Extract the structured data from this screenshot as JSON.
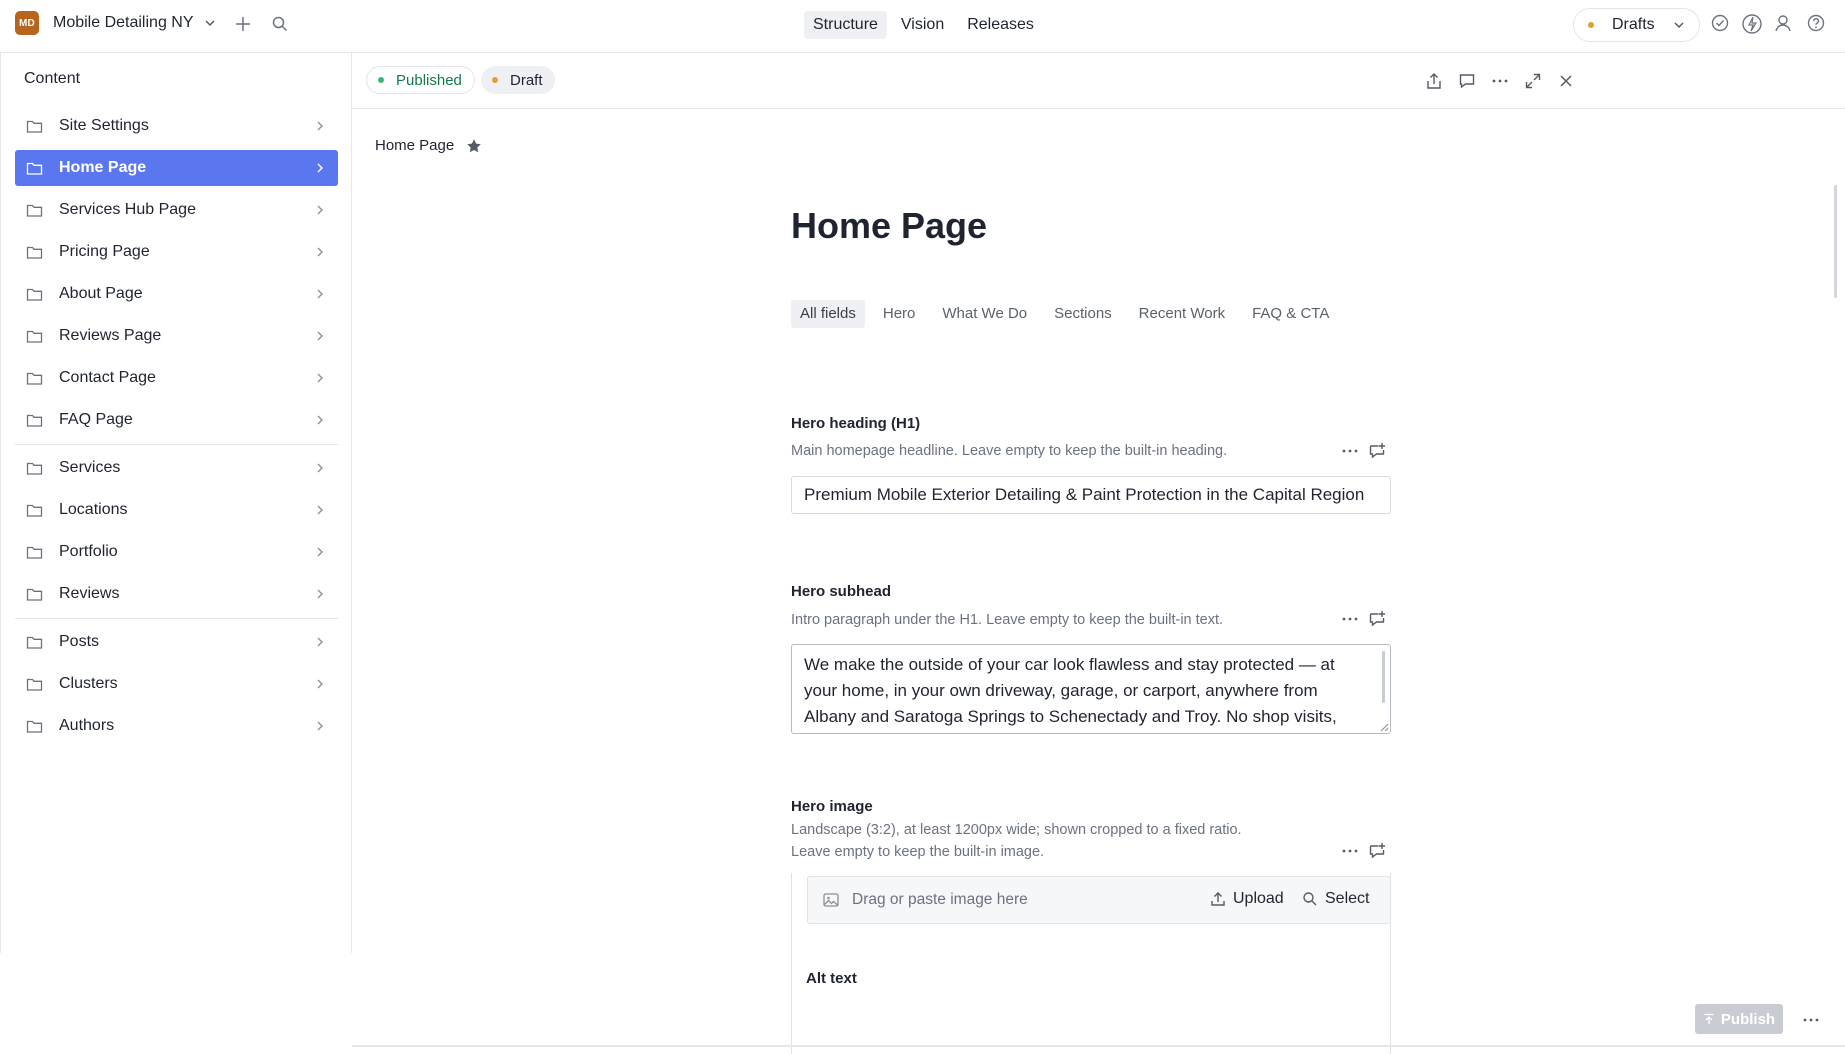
{
  "topbar": {
    "workspace_initials": "MD",
    "workspace_name": "Mobile Detailing NY",
    "nav": [
      {
        "label": "Structure",
        "active": true
      },
      {
        "label": "Vision",
        "active": false
      },
      {
        "label": "Releases",
        "active": false
      }
    ],
    "perspective_label": "Drafts"
  },
  "sidebar": {
    "title": "Content",
    "items": [
      {
        "label": "Site Settings",
        "icon": "folder-icon"
      },
      {
        "label": "Home Page",
        "icon": "folder-icon",
        "active": true
      },
      {
        "label": "Services Hub Page",
        "icon": "folder-icon"
      },
      {
        "label": "Pricing Page",
        "icon": "folder-icon"
      },
      {
        "label": "About Page",
        "icon": "folder-icon"
      },
      {
        "label": "Reviews Page",
        "icon": "folder-icon"
      },
      {
        "label": "Contact Page",
        "icon": "folder-icon"
      },
      {
        "label": "FAQ Page",
        "icon": "folder-icon"
      },
      {
        "label": "Services",
        "icon": "folder-icon"
      },
      {
        "label": "Locations",
        "icon": "folder-icon"
      },
      {
        "label": "Portfolio",
        "icon": "folder-icon"
      },
      {
        "label": "Reviews",
        "icon": "folder-icon"
      },
      {
        "label": "Posts",
        "icon": "folder-icon"
      },
      {
        "label": "Clusters",
        "icon": "folder-icon"
      },
      {
        "label": "Authors",
        "icon": "folder-icon"
      }
    ]
  },
  "document": {
    "status_published": "Published",
    "status_draft": "Draft",
    "breadcrumb": "Home Page",
    "title": "Home Page",
    "tabs": [
      {
        "label": "All fields",
        "active": true
      },
      {
        "label": "Hero"
      },
      {
        "label": "What We Do"
      },
      {
        "label": "Sections"
      },
      {
        "label": "Recent Work"
      },
      {
        "label": "FAQ & CTA"
      }
    ],
    "hero_heading": {
      "label": "Hero heading (H1)",
      "description": "Main homepage headline. Leave empty to keep the built-in heading.",
      "value": "Premium Mobile Exterior Detailing & Paint Protection in the Capital Region"
    },
    "hero_subhead": {
      "label": "Hero subhead",
      "description": "Intro paragraph under the H1. Leave empty to keep the built-in text.",
      "value": "We make the outside of your car look flawless and stay protected — at your home, in your own driveway, garage, or carport, anywhere from Albany and Saratoga Springs to Schenectady and Troy. No shop visits, no lost time — we come to you."
    },
    "hero_image": {
      "label": "Hero image",
      "description_line1": "Landscape (3:2), at least 1200px wide; shown cropped to a fixed ratio.",
      "description_line2": "Leave empty to keep the built-in image.",
      "drop_text": "Drag or paste image here",
      "upload_label": "Upload",
      "select_label": "Select",
      "alt_label": "Alt text"
    },
    "publish_label": "Publish"
  },
  "colors": {
    "accent": "#5b77f0",
    "published": "#137a4c",
    "draft_dot": "#e0a02b",
    "avatar": "#b8641c"
  }
}
